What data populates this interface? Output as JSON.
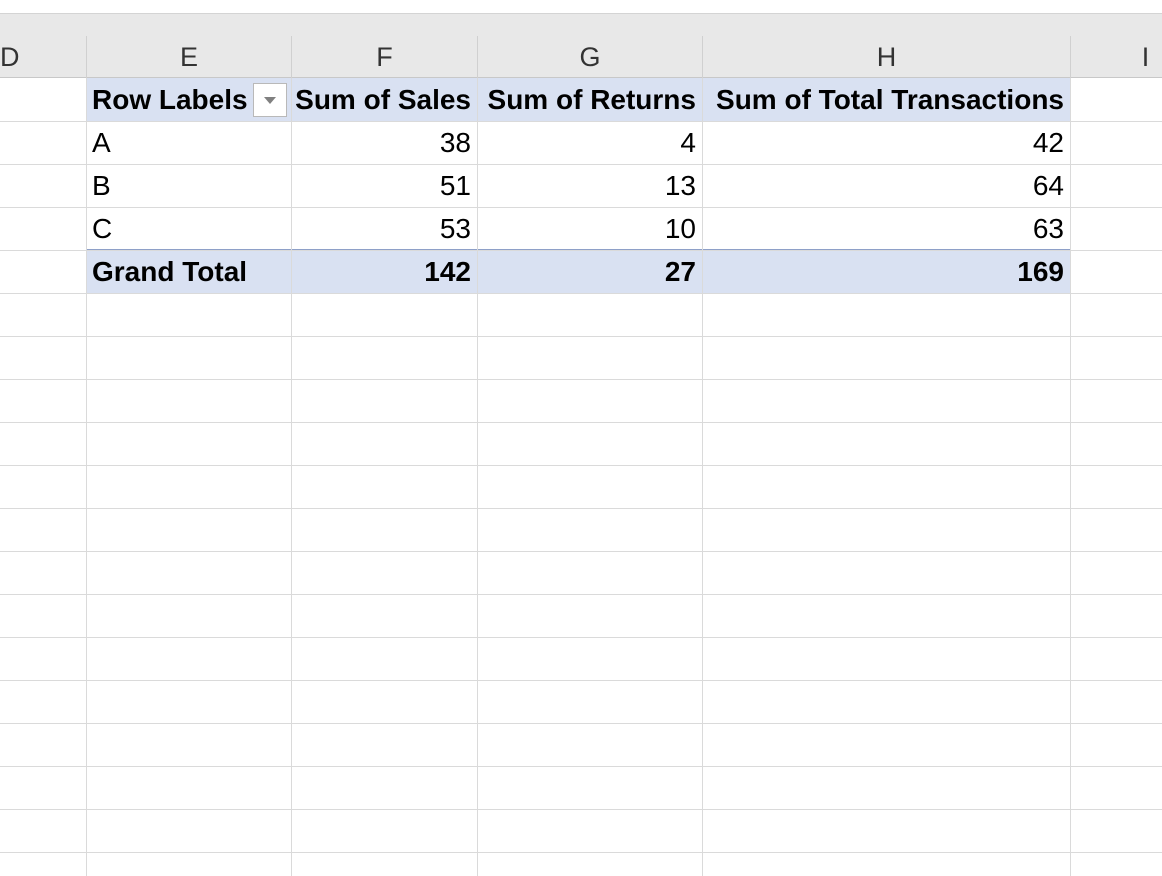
{
  "columns": {
    "D": "D",
    "E": "E",
    "F": "F",
    "G": "G",
    "H": "H",
    "I": "I"
  },
  "pivot": {
    "headers": {
      "row_labels": "Row Labels",
      "sum_sales": "Sum of Sales",
      "sum_returns": "Sum of Returns",
      "sum_total": "Sum of Total Transactions"
    },
    "rows": [
      {
        "label": "A",
        "sales": "38",
        "returns": "4",
        "total": "42"
      },
      {
        "label": "B",
        "sales": "51",
        "returns": "13",
        "total": "64"
      },
      {
        "label": "C",
        "sales": "53",
        "returns": "10",
        "total": "63"
      }
    ],
    "grand_total": {
      "label": "Grand Total",
      "sales": "142",
      "returns": "27",
      "total": "169"
    },
    "filter_icon": "dropdown-arrow-icon",
    "header_fill": "#d9e1f2"
  }
}
